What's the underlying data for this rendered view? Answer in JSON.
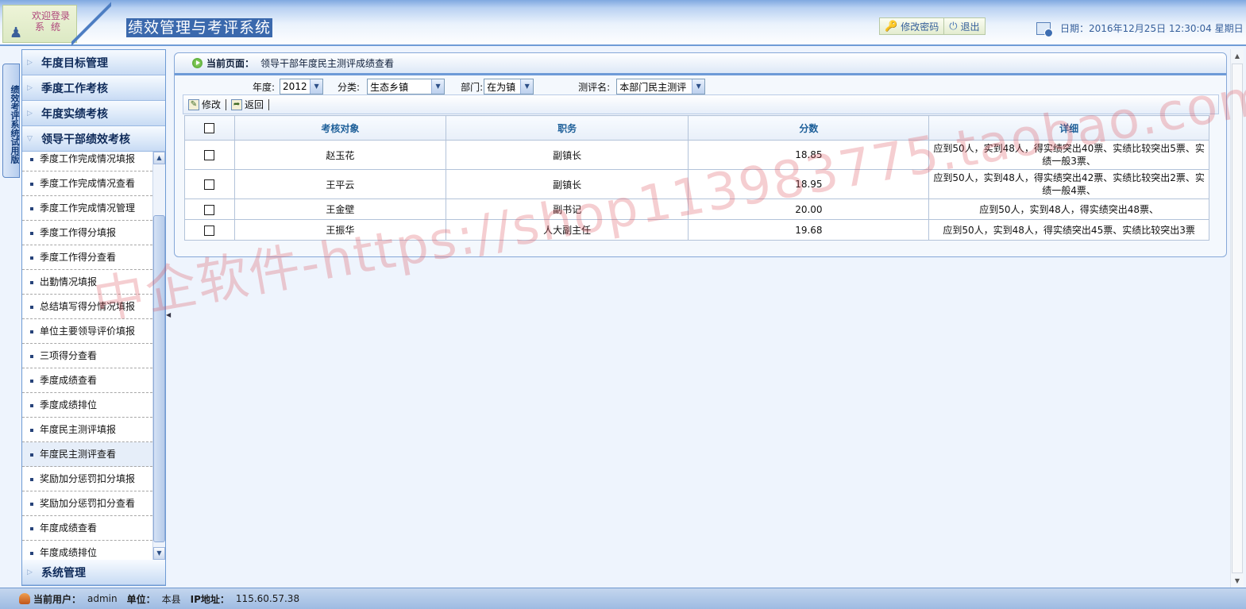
{
  "header": {
    "logo_line1": "欢迎登录",
    "logo_line2": "系统",
    "system_title": "绩效管理与考评系统",
    "change_password": "修改密码",
    "logout": "退出",
    "date_text": "日期：2016年12月25日  12:30:04 星期日"
  },
  "vertical_tab": {
    "label": "绩效考评系统试用版"
  },
  "sidebar": {
    "groups_top": [
      {
        "label": "年度目标管理"
      },
      {
        "label": "季度工作考核"
      },
      {
        "label": "年度实绩考核"
      },
      {
        "label": "领导干部绩效考核"
      }
    ],
    "items": [
      {
        "label": "季度工作完成情况填报"
      },
      {
        "label": "季度工作完成情况查看"
      },
      {
        "label": "季度工作完成情况管理"
      },
      {
        "label": "季度工作得分填报"
      },
      {
        "label": "季度工作得分查看"
      },
      {
        "label": "出勤情况填报"
      },
      {
        "label": "总结填写得分情况填报"
      },
      {
        "label": "单位主要领导评价填报"
      },
      {
        "label": "三项得分查看"
      },
      {
        "label": "季度成绩查看"
      },
      {
        "label": "季度成绩排位"
      },
      {
        "label": "年度民主测评填报"
      },
      {
        "label": "年度民主测评查看"
      },
      {
        "label": "奖励加分惩罚扣分填报"
      },
      {
        "label": "奖励加分惩罚扣分查看"
      },
      {
        "label": "年度成绩查看"
      },
      {
        "label": "年度成绩排位"
      }
    ],
    "group_bottom": {
      "label": "系统管理"
    }
  },
  "breadcrumb": {
    "label": "当前页面：",
    "value": "领导干部年度民主测评成绩查看"
  },
  "filters": {
    "year_label": "年度:",
    "year_value": "2012",
    "category_label": "分类:",
    "category_value": "生态乡镇",
    "dept_label": "部门:",
    "dept_value": "在为镇",
    "eval_label": "测评名:",
    "eval_value": "本部门民主测评"
  },
  "toolbar": {
    "edit": "修改",
    "back": "返回"
  },
  "table": {
    "headers": {
      "target": "考核对象",
      "position": "职务",
      "score": "分数",
      "detail": "详细"
    },
    "rows": [
      {
        "name": "赵玉花",
        "position": "副镇长",
        "score": "18.85",
        "detail": "应到50人，实到48人，得实绩突出40票、实绩比较突出5票、实绩一般3票、"
      },
      {
        "name": "王平云",
        "position": "副镇长",
        "score": "18.95",
        "detail": "应到50人，实到48人，得实绩突出42票、实绩比较突出2票、实绩一般4票、"
      },
      {
        "name": "王金壁",
        "position": "副书记",
        "score": "20.00",
        "detail": "应到50人，实到48人，得实绩突出48票、"
      },
      {
        "name": "王振华",
        "position": "人大副主任",
        "score": "19.68",
        "detail": "应到50人，实到48人，得实绩突出45票、实绩比较突出3票"
      }
    ]
  },
  "status": {
    "user_label": "当前用户：",
    "user_value": "admin",
    "unit_label": "单位：",
    "unit_value": "本县",
    "ip_label": "IP地址：",
    "ip_value": "115.60.57.38"
  },
  "watermark": "中企软件-https://shop113983775.taobao.com",
  "colors": {
    "accent": "#3b69ad",
    "panel_border": "#86a8d8",
    "header_text": "#1d5f99"
  }
}
